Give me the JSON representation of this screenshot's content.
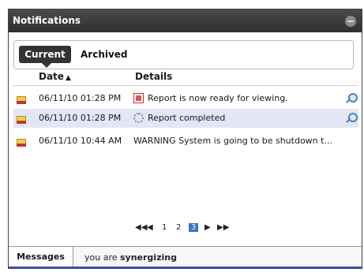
{
  "panel": {
    "title": "Notifications"
  },
  "tabs": {
    "current": "Current",
    "archived": "Archived"
  },
  "columns": {
    "date": "Date",
    "sort": "▲",
    "details": "Details"
  },
  "rows": [
    {
      "date": "06/11/10 01:28 PM",
      "detail": "Report is now ready for viewing.",
      "icon": "pdf-icon",
      "action": "zoom-icon",
      "selected": false
    },
    {
      "date": "06/11/10 01:28 PM",
      "detail": "Report completed",
      "icon": "gear-icon",
      "action": "zoom-icon",
      "selected": true
    },
    {
      "date": "06/11/10 10:44 AM",
      "detail": "WARNING System is going to be shutdown t...",
      "icon": "",
      "action": "",
      "selected": false
    }
  ],
  "pager": {
    "first": "◀◀",
    "prev": "◀",
    "pages": [
      "1",
      "2",
      "3"
    ],
    "current": "3",
    "next": "▶",
    "last": "▶▶"
  },
  "bottom": {
    "tab": "Messages",
    "status_prefix": "you are ",
    "status_bold": "synergizing"
  },
  "colors": {
    "titlebar": "#333333",
    "selected_row": "#e4e6f5",
    "page_active": "#3a6fc4",
    "stripe": "#3a4ea0"
  }
}
